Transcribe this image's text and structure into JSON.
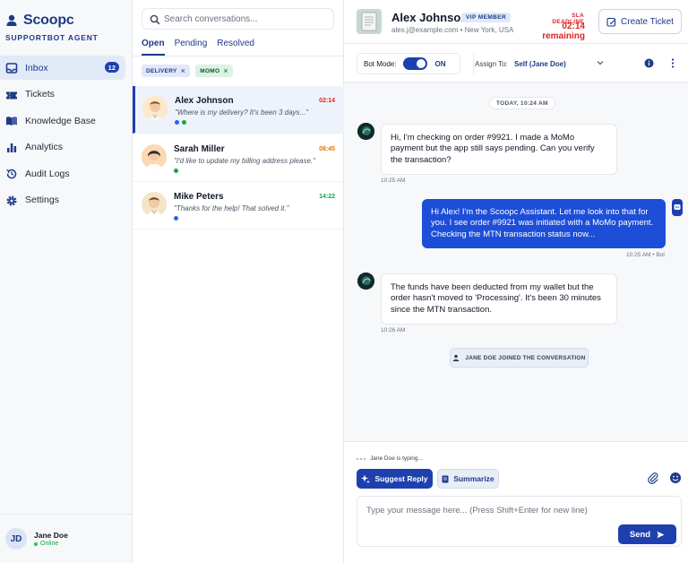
{
  "brand": {
    "name": "Scoopc",
    "subtitle": "SUPPORTBOT AGENT",
    "color": "#1e3a8a"
  },
  "nav": {
    "items": [
      {
        "label": "Inbox",
        "icon": "inbox-icon",
        "badge": "12",
        "active": true
      },
      {
        "label": "Tickets",
        "icon": "ticket-icon"
      },
      {
        "label": "Knowledge Base",
        "icon": "book-icon"
      },
      {
        "label": "Analytics",
        "icon": "bar-chart-icon"
      },
      {
        "label": "Audit Logs",
        "icon": "history-icon"
      },
      {
        "label": "Settings",
        "icon": "gear-icon"
      }
    ]
  },
  "agent": {
    "initials": "JD",
    "name": "Jane Doe",
    "status": "Online"
  },
  "search": {
    "placeholder": "Search conversations..."
  },
  "tabs": [
    {
      "label": "Open",
      "active": true
    },
    {
      "label": "Pending"
    },
    {
      "label": "Resolved"
    }
  ],
  "filters": [
    {
      "label": "DELIVERY"
    },
    {
      "label": "MOMO"
    }
  ],
  "conversations": [
    {
      "name": "Alex Johnson",
      "time": "02:14",
      "time_color": "#dc2626",
      "preview": "\"Where is my delivery? It's been 3 days...\"",
      "status_dots": [
        "#2563eb",
        "#16a34a"
      ]
    },
    {
      "name": "Sarah Miller",
      "time": "08:45",
      "time_color": "#d97706",
      "preview": "\"I'd like to update my billing address please.\"",
      "status_dots": [
        "#16a34a"
      ]
    },
    {
      "name": "Mike Peters",
      "time": "14:22",
      "time_color": "#16a34a",
      "preview": "\"Thanks for the help! That solved it.\"",
      "status_dots": [
        "#2563eb"
      ]
    }
  ],
  "customer": {
    "name": "Alex Johnson",
    "badge": "VIP MEMBER",
    "meta": "alex.j@example.com • New York, USA"
  },
  "sla": {
    "label": "SLA DEADLINE",
    "value": "02:14 remaining"
  },
  "header": {
    "create_ticket": "Create Ticket"
  },
  "toolbar": {
    "bot_mode_label": "Bot Mode:",
    "bot_mode_state": "ON",
    "assign_label": "Assign To:",
    "assign_value": "Self (Jane Doe)"
  },
  "messages": {
    "day": "TODAY, 10:24 AM",
    "m1": {
      "text": "Hi, I'm checking on order #9921. I made a MoMo payment but the app still says pending. Can you verify the transaction?",
      "time": "10:25 AM"
    },
    "m2": {
      "text": "Hi Alex! I'm the Scoopc Assistant. Let me look into that for you. I see order #9921 was initiated with a MoMo payment. Checking the MTN transaction status now...",
      "time": "10:25 AM • Bot"
    },
    "m3": {
      "text": "The funds have been deducted from my wallet but the order hasn't moved to 'Processing'. It's been 30 minutes since the MTN transaction.",
      "time": "10:26 AM"
    },
    "system": "JANE DOE JOINED THE CONVERSATION"
  },
  "composer": {
    "typing": "Jane Doe is typing...",
    "suggest": "Suggest Reply",
    "summarize": "Summarize",
    "placeholder": "Type your message here... (Press Shift+Enter for new line)",
    "send": "Send"
  }
}
